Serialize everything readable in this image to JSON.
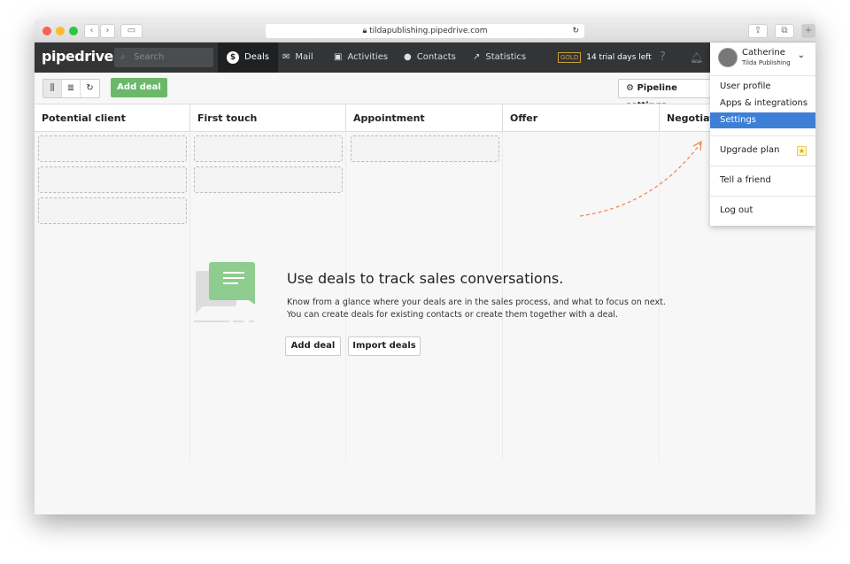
{
  "browser": {
    "url": "tildapublishing.pipedrive.com"
  },
  "nav": {
    "logo": "pipedrive",
    "search_placeholder": "Search",
    "items": [
      {
        "label": "Deals"
      },
      {
        "label": "Mail"
      },
      {
        "label": "Activities"
      },
      {
        "label": "Contacts"
      },
      {
        "label": "Statistics"
      }
    ],
    "badge": "GOLD",
    "trial": "14 trial days left"
  },
  "user": {
    "name": "Catherine",
    "company": "Tilda Publishing"
  },
  "toolbar": {
    "add_deal": "Add deal",
    "pipeline_settings": "Pipeline settings"
  },
  "stages": [
    "Potential client",
    "First touch",
    "Appointment",
    "Offer",
    "Negotiati"
  ],
  "empty": {
    "title": "Use deals to track sales conversations.",
    "line1": "Know from a glance where your deals are in the sales process, and what to focus on next.",
    "line2": "You can create deals for existing contacts or create them together with a deal.",
    "add": "Add deal",
    "import": "Import deals"
  },
  "menu": {
    "items": [
      "User profile",
      "Apps & integrations",
      "Settings",
      "Upgrade plan",
      "Tell a friend",
      "Log out"
    ],
    "selected": "Settings"
  },
  "colors": {
    "accent": "#6ab96a",
    "selected": "#3d7fd6"
  }
}
